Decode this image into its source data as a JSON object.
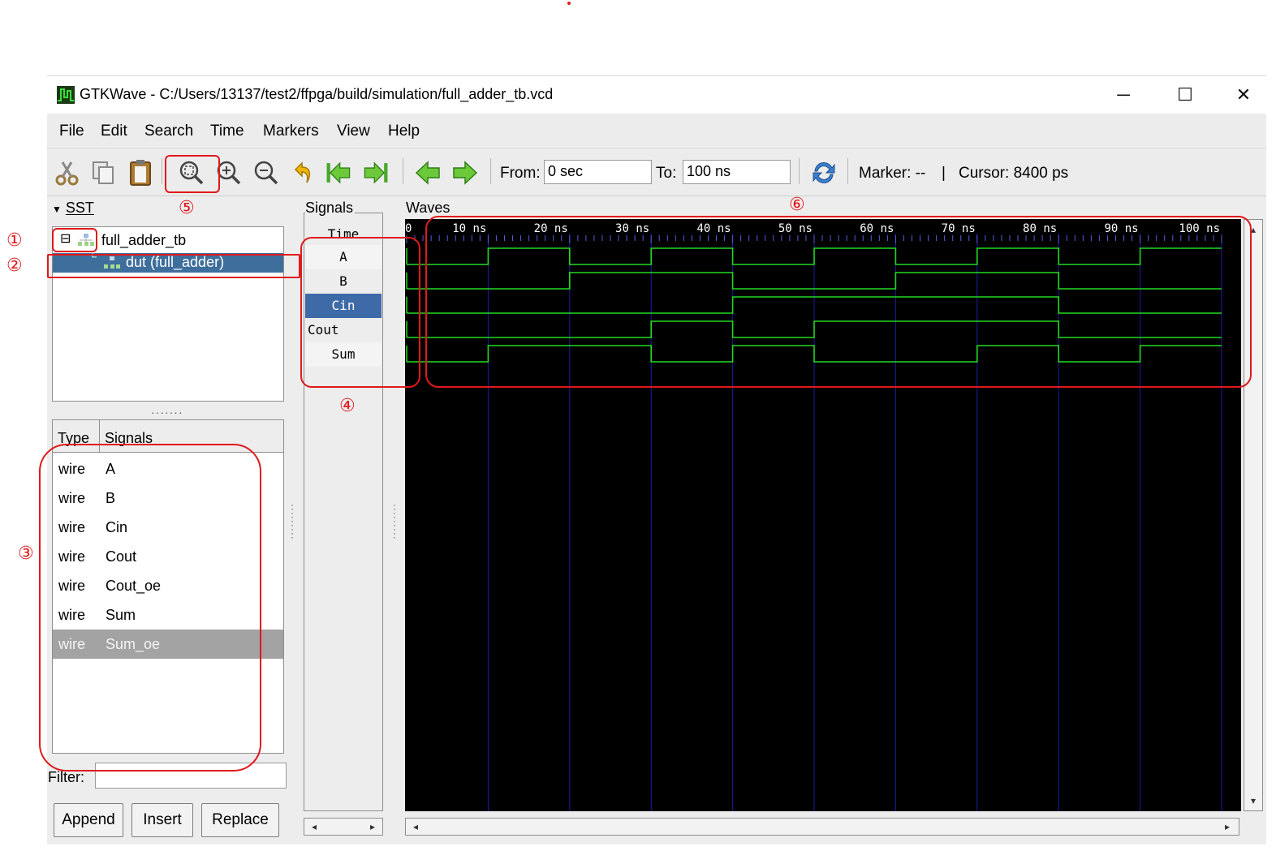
{
  "window": {
    "title": "GTKWave - C:/Users/13137/test2/ffpga/build/simulation/full_adder_tb.vcd",
    "controls": {
      "minimize": "─",
      "maximize": "☐",
      "close": "✕"
    }
  },
  "menu": [
    "File",
    "Edit",
    "Search",
    "Time",
    "Markers",
    "View",
    "Help"
  ],
  "toolbar": {
    "from_label": "From:",
    "from_value": "0 sec",
    "to_label": "To:",
    "to_value": "100 ns",
    "marker": "Marker: --",
    "separator": "|",
    "cursor": "Cursor: 8400 ps",
    "icons": [
      "cut-icon",
      "copy-icon",
      "paste-icon",
      "zoom-fit-icon",
      "zoom-in-icon",
      "zoom-out-icon",
      "undo-icon",
      "to-start-icon",
      "to-end-icon",
      "prev-icon",
      "next-icon",
      "reload-icon"
    ]
  },
  "sst": {
    "header": "SST",
    "tree": [
      {
        "label": "full_adder_tb",
        "expander": "⊟"
      },
      {
        "label": "dut  (full_adder)",
        "selected": true
      }
    ],
    "grip": "·······",
    "columns": {
      "type": "Type",
      "signals": "Signals"
    },
    "signals": [
      {
        "type": "wire",
        "name": "A"
      },
      {
        "type": "wire",
        "name": "B"
      },
      {
        "type": "wire",
        "name": "Cin"
      },
      {
        "type": "wire",
        "name": "Cout"
      },
      {
        "type": "wire",
        "name": "Cout_oe"
      },
      {
        "type": "wire",
        "name": "Sum"
      },
      {
        "type": "wire",
        "name": "Sum_oe",
        "selected": true
      }
    ],
    "filter_label": "Filter:",
    "filter_value": "",
    "buttons": {
      "append": "Append",
      "insert": "Insert",
      "replace": "Replace"
    }
  },
  "signals_panel": {
    "label": "Signals",
    "time_label": "Time",
    "names": [
      "A",
      "B",
      "Cin",
      "Cout",
      "Sum"
    ],
    "selected": "Cin"
  },
  "waves_panel": {
    "label": "Waves",
    "colors": {
      "background": "#000000",
      "grid": "#1c1ca8",
      "trace": "#22d922",
      "ruler_text": "#ffffff"
    }
  },
  "chart_data": {
    "type": "line",
    "x_unit": "ns",
    "xlim": [
      0,
      100
    ],
    "tick_labels": [
      "0",
      "10 ns",
      "20 ns",
      "30 ns",
      "40 ns",
      "50 ns",
      "60 ns",
      "70 ns",
      "80 ns",
      "90 ns",
      "100 ns"
    ],
    "series": [
      {
        "name": "A",
        "transitions": [
          [
            0,
            0
          ],
          [
            10,
            1
          ],
          [
            20,
            0
          ],
          [
            30,
            1
          ],
          [
            40,
            0
          ],
          [
            50,
            1
          ],
          [
            60,
            0
          ],
          [
            70,
            1
          ],
          [
            80,
            0
          ],
          [
            90,
            1
          ]
        ]
      },
      {
        "name": "B",
        "transitions": [
          [
            0,
            0
          ],
          [
            20,
            1
          ],
          [
            40,
            0
          ],
          [
            60,
            1
          ],
          [
            80,
            0
          ]
        ]
      },
      {
        "name": "Cin",
        "transitions": [
          [
            0,
            0
          ],
          [
            40,
            1
          ],
          [
            80,
            0
          ]
        ]
      },
      {
        "name": "Cout",
        "transitions": [
          [
            0,
            0
          ],
          [
            30,
            1
          ],
          [
            40,
            0
          ],
          [
            50,
            1
          ],
          [
            80,
            0
          ]
        ]
      },
      {
        "name": "Sum",
        "transitions": [
          [
            0,
            0
          ],
          [
            10,
            1
          ],
          [
            30,
            0
          ],
          [
            40,
            1
          ],
          [
            50,
            0
          ],
          [
            70,
            1
          ],
          [
            80,
            0
          ],
          [
            90,
            1
          ]
        ]
      }
    ]
  },
  "annotations": [
    "①",
    "②",
    "③",
    "④",
    "⑤",
    "⑥"
  ]
}
